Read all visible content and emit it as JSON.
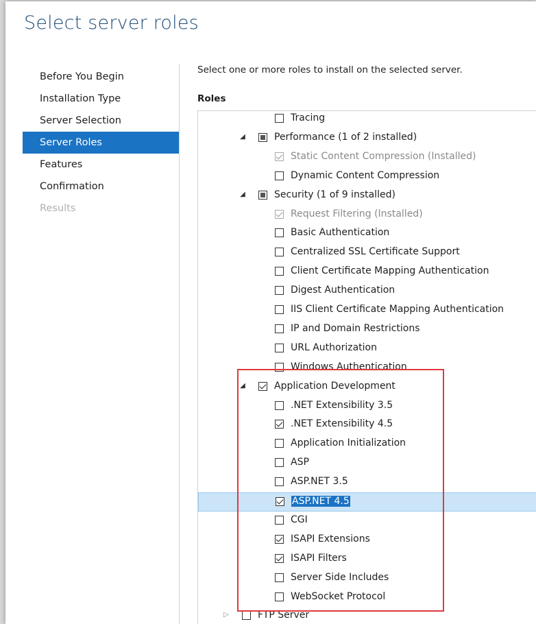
{
  "page": {
    "title": "Select server roles"
  },
  "nav": {
    "items": [
      {
        "label": "Before You Begin",
        "state": "normal"
      },
      {
        "label": "Installation Type",
        "state": "normal"
      },
      {
        "label": "Server Selection",
        "state": "normal"
      },
      {
        "label": "Server Roles",
        "state": "active"
      },
      {
        "label": "Features",
        "state": "normal"
      },
      {
        "label": "Confirmation",
        "state": "normal"
      },
      {
        "label": "Results",
        "state": "disabled"
      }
    ]
  },
  "main": {
    "instruction": "Select one or more roles to install on the selected server.",
    "roles_label": "Roles"
  },
  "tree": [
    {
      "label": "Tracing",
      "level": 2,
      "check": "unchecked"
    },
    {
      "label": "Performance (1 of 2 installed)",
      "level": 1,
      "check": "partial",
      "expander": "expanded"
    },
    {
      "label": "Static Content Compression (Installed)",
      "level": 2,
      "check": "checked",
      "disabled": true
    },
    {
      "label": "Dynamic Content Compression",
      "level": 2,
      "check": "unchecked"
    },
    {
      "label": "Security (1 of 9 installed)",
      "level": 1,
      "check": "partial",
      "expander": "expanded"
    },
    {
      "label": "Request Filtering (Installed)",
      "level": 2,
      "check": "checked",
      "disabled": true
    },
    {
      "label": "Basic Authentication",
      "level": 2,
      "check": "unchecked"
    },
    {
      "label": "Centralized SSL Certificate Support",
      "level": 2,
      "check": "unchecked"
    },
    {
      "label": "Client Certificate Mapping Authentication",
      "level": 2,
      "check": "unchecked"
    },
    {
      "label": "Digest Authentication",
      "level": 2,
      "check": "unchecked"
    },
    {
      "label": "IIS Client Certificate Mapping Authentication",
      "level": 2,
      "check": "unchecked"
    },
    {
      "label": "IP and Domain Restrictions",
      "level": 2,
      "check": "unchecked"
    },
    {
      "label": "URL Authorization",
      "level": 2,
      "check": "unchecked"
    },
    {
      "label": "Windows Authentication",
      "level": 2,
      "check": "unchecked"
    },
    {
      "label": "Application Development",
      "level": 1,
      "check": "checked",
      "expander": "expanded"
    },
    {
      "label": ".NET Extensibility 3.5",
      "level": 2,
      "check": "unchecked"
    },
    {
      "label": ".NET Extensibility 4.5",
      "level": 2,
      "check": "checked"
    },
    {
      "label": "Application Initialization",
      "level": 2,
      "check": "unchecked"
    },
    {
      "label": "ASP",
      "level": 2,
      "check": "unchecked"
    },
    {
      "label": "ASP.NET 3.5",
      "level": 2,
      "check": "unchecked"
    },
    {
      "label": "ASP.NET 4.5",
      "level": 2,
      "check": "checked",
      "selected": true
    },
    {
      "label": "CGI",
      "level": 2,
      "check": "unchecked"
    },
    {
      "label": "ISAPI Extensions",
      "level": 2,
      "check": "checked"
    },
    {
      "label": "ISAPI Filters",
      "level": 2,
      "check": "checked"
    },
    {
      "label": "Server Side Includes",
      "level": 2,
      "check": "unchecked"
    },
    {
      "label": "WebSocket Protocol",
      "level": 2,
      "check": "unchecked"
    },
    {
      "label": "FTP Server",
      "level": 0,
      "check": "unchecked",
      "expander": "collapsed"
    }
  ],
  "colors": {
    "title": "#1e4e79",
    "active_nav": "#1b73c4",
    "selection_row": "#cce4f7",
    "highlight_box": "#e0393e"
  }
}
